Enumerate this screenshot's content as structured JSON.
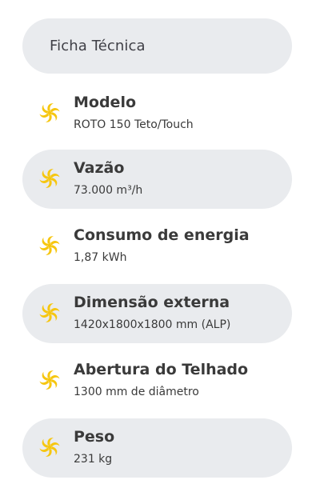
{
  "header": {
    "title": "Ficha Técnica"
  },
  "accent_color": "#f6c60f",
  "specs": [
    {
      "title": "Modelo",
      "value": "ROTO 150 Teto/Touch",
      "icon": "fan-icon"
    },
    {
      "title": "Vazão",
      "value": "73.000 m³/h",
      "icon": "fan-icon"
    },
    {
      "title": "Consumo de energia",
      "value": "1,87 kWh",
      "icon": "fan-icon"
    },
    {
      "title": "Dimensão externa",
      "value": "1420x1800x1800 mm (ALP)",
      "icon": "fan-icon"
    },
    {
      "title": "Abertura do Telhado",
      "value": "1300 mm de diâmetro",
      "icon": "fan-icon"
    },
    {
      "title": "Peso",
      "value": "231 kg",
      "icon": "fan-icon"
    }
  ]
}
